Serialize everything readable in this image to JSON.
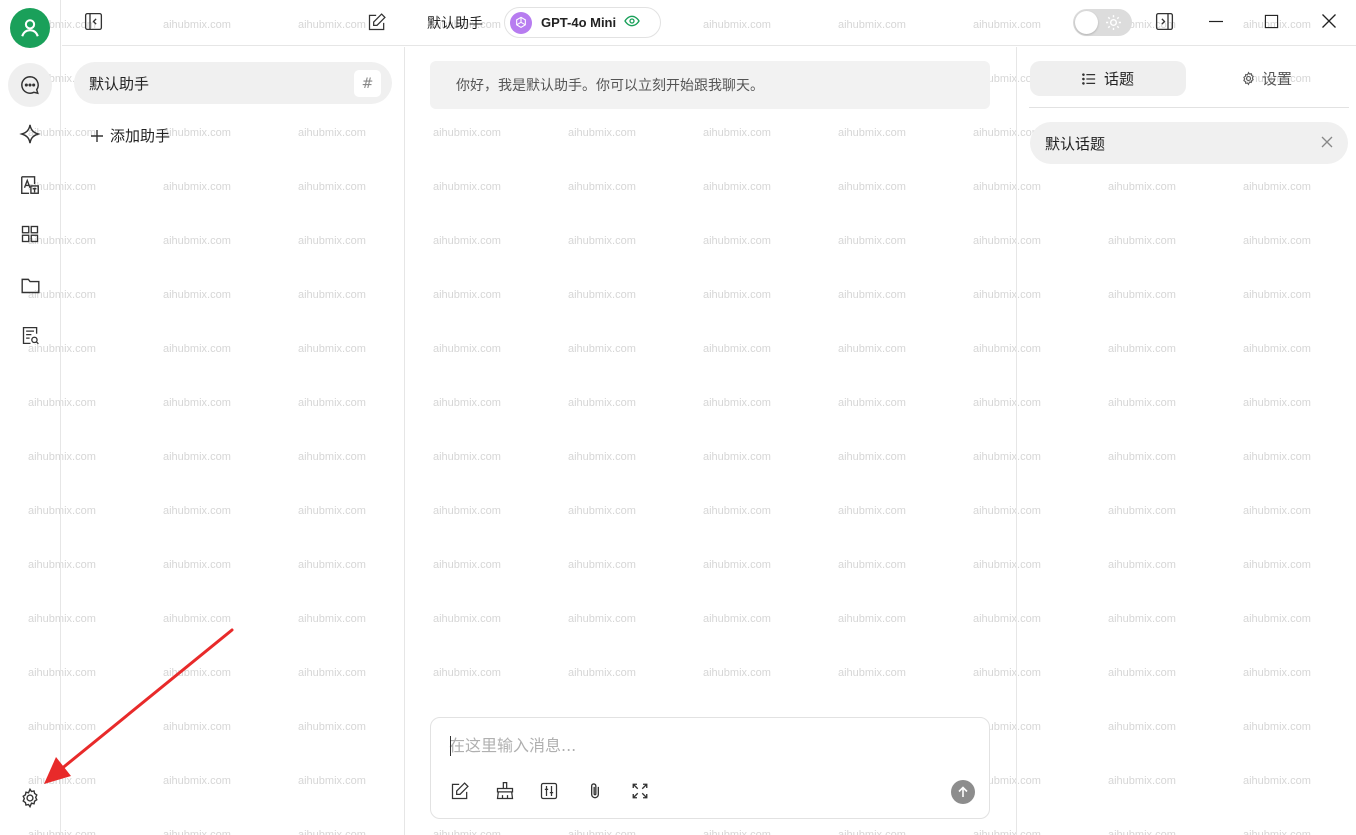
{
  "watermark": "aihubmix.com",
  "rail": {
    "items": [
      {
        "name": "chat-icon"
      },
      {
        "name": "sparkle-icon"
      },
      {
        "name": "translate-icon"
      },
      {
        "name": "apps-grid-icon"
      },
      {
        "name": "folder-icon"
      },
      {
        "name": "doc-search-icon"
      }
    ],
    "settings_icon": "gear-icon"
  },
  "header": {
    "title": "默认助手",
    "model_name": "GPT-4o Mini"
  },
  "assistants": {
    "items": [
      {
        "label": "默认助手"
      }
    ],
    "hash_symbol": "#",
    "add_label": "添加助手"
  },
  "chat": {
    "greeting": "你好，我是默认助手。你可以立刻开始跟我聊天。",
    "input_placeholder": "在这里输入消息...",
    "input_value": ""
  },
  "topics": {
    "tab_topics_label": "话题",
    "tab_settings_label": "设置",
    "items": [
      {
        "label": "默认话题"
      }
    ]
  },
  "colors": {
    "accent": "#1aa05a",
    "annotation_arrow": "#e82a2a",
    "model_logo": "#b77cf0"
  }
}
